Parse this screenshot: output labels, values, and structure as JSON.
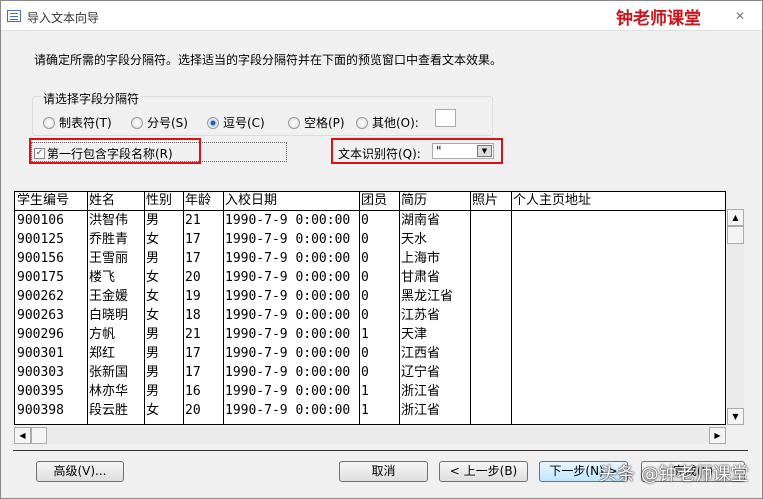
{
  "window": {
    "title": "导入文本向导",
    "brand": "钟老师课堂",
    "close": "✕"
  },
  "instruction": "请确定所需的字段分隔符。选择适当的字段分隔符并在下面的预览窗口中查看文本效果。",
  "delimiter": {
    "label": "请选择字段分隔符",
    "options": [
      {
        "label": "制表符(T)",
        "selected": false
      },
      {
        "label": "分号(S)",
        "selected": false
      },
      {
        "label": "逗号(C)",
        "selected": true
      },
      {
        "label": "空格(P)",
        "selected": false
      },
      {
        "label": "其他(O):",
        "selected": false
      }
    ],
    "other_value": ""
  },
  "first_row_names": {
    "label": "第一行包含字段名称(R)",
    "checked": true,
    "check": "✓"
  },
  "text_qualifier": {
    "label": "文本识别符(Q):",
    "value": "\""
  },
  "table": {
    "columns": [
      "学生编号",
      "姓名",
      "性别",
      "年龄",
      "入校日期",
      "团员",
      "简历",
      "照片",
      "个人主页地址"
    ],
    "rows": [
      [
        "900106",
        "洪智伟",
        "男",
        "21",
        "1990-7-9 0:00:00",
        "0",
        "湖南省",
        "",
        ""
      ],
      [
        "900125",
        "乔胜青",
        "女",
        "17",
        "1990-7-9 0:00:00",
        "0",
        "天水",
        "",
        ""
      ],
      [
        "900156",
        "王雪丽",
        "男",
        "17",
        "1990-7-9 0:00:00",
        "0",
        "上海市",
        "",
        ""
      ],
      [
        "900175",
        "楼飞",
        "女",
        "20",
        "1990-7-9 0:00:00",
        "0",
        "甘肃省",
        "",
        ""
      ],
      [
        "900262",
        "王金媛",
        "女",
        "19",
        "1990-7-9 0:00:00",
        "0",
        "黑龙江省",
        "",
        ""
      ],
      [
        "900263",
        "白晓明",
        "女",
        "18",
        "1990-7-9 0:00:00",
        "0",
        "江苏省",
        "",
        ""
      ],
      [
        "900296",
        "方帆",
        "男",
        "21",
        "1990-7-9 0:00:00",
        "1",
        "天津",
        "",
        ""
      ],
      [
        "900301",
        "郑红",
        "男",
        "17",
        "1990-7-9 0:00:00",
        "0",
        "江西省",
        "",
        ""
      ],
      [
        "900303",
        "张新国",
        "男",
        "17",
        "1990-7-9 0:00:00",
        "0",
        "辽宁省",
        "",
        ""
      ],
      [
        "900395",
        "林亦华",
        "男",
        "16",
        "1990-7-9 0:00:00",
        "1",
        "浙江省",
        "",
        ""
      ],
      [
        "900398",
        "段云胜",
        "女",
        "20",
        "1990-7-9 0:00:00",
        "1",
        "浙江省",
        "",
        ""
      ]
    ]
  },
  "buttons": {
    "advanced": "高级(V)...",
    "cancel": "取消",
    "back": "< 上一步(B)",
    "next": "下一步(N) >",
    "finish": "完成(F)"
  },
  "watermark": "头条 @钟老师课堂"
}
